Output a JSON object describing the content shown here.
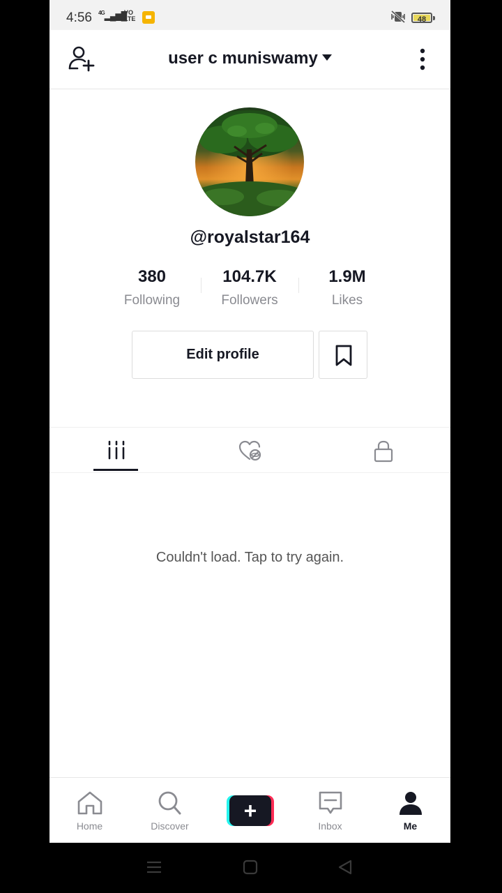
{
  "status_bar": {
    "time": "4:56",
    "network": "4G",
    "volte": "VO LTE",
    "battery": "48"
  },
  "header": {
    "title": "user c muniswamy"
  },
  "profile": {
    "handle": "@royalstar164",
    "stats": [
      {
        "value": "380",
        "label": "Following"
      },
      {
        "value": "104.7K",
        "label": "Followers"
      },
      {
        "value": "1.9M",
        "label": "Likes"
      }
    ],
    "edit_label": "Edit profile"
  },
  "tabs": {
    "items": [
      {
        "icon": "videos-grid-icon",
        "active": true
      },
      {
        "icon": "liked-videos-icon",
        "active": false
      },
      {
        "icon": "lock-icon",
        "active": false
      }
    ]
  },
  "content": {
    "empty_message": "Couldn't load. Tap to try again."
  },
  "bottom_nav": {
    "items": [
      {
        "label": "Home",
        "icon": "home-icon",
        "active": false
      },
      {
        "label": "Discover",
        "icon": "search-icon",
        "active": false
      },
      {
        "label": "",
        "icon": "plus-icon",
        "active": false
      },
      {
        "label": "Inbox",
        "icon": "inbox-icon",
        "active": false
      },
      {
        "label": "Me",
        "icon": "person-icon",
        "active": true
      }
    ]
  },
  "colors": {
    "text": "#161823",
    "muted": "#8a8b91",
    "accent_cyan": "#25f4ee",
    "accent_pink": "#fe2c55"
  }
}
